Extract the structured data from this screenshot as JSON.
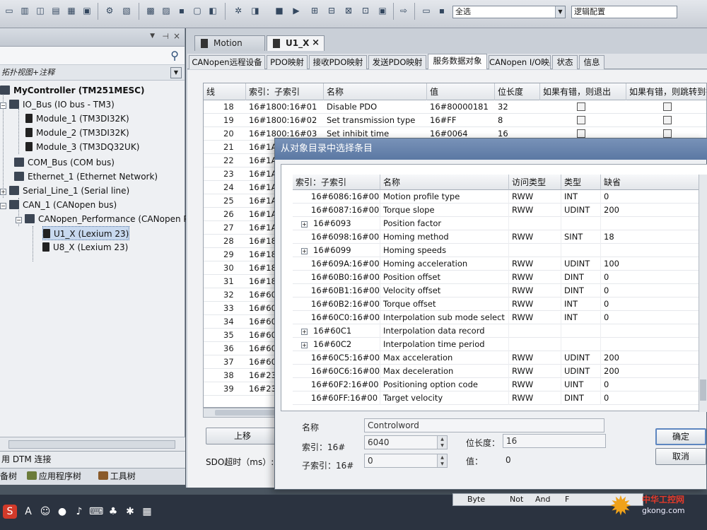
{
  "toolbar": {
    "filter_select": "全选",
    "view_select": "逻辑配置"
  },
  "left_pane": {
    "column_header": "拓扑视图+注释",
    "tree": [
      {
        "label": "MyController (TM251MESC)",
        "bold": true
      },
      {
        "label": "IO_Bus (IO bus - TM3)"
      },
      {
        "label": "Module_1 (TM3DI32K)"
      },
      {
        "label": "Module_2 (TM3DI32K)"
      },
      {
        "label": "Module_3 (TM3DQ32UK)"
      },
      {
        "label": "COM_Bus (COM bus)"
      },
      {
        "label": "Ethernet_1 (Ethernet Network)"
      },
      {
        "label": "Serial_Line_1 (Serial line)"
      },
      {
        "label": "CAN_1 (CANopen bus)"
      },
      {
        "label": "CANopen_Performance (CANopen Per"
      },
      {
        "label": "U1_X (Lexium 23)",
        "selected": true
      },
      {
        "label": "U8_X (Lexium 23)"
      }
    ],
    "status_text": "用 DTM 连接",
    "bottom_tabs": [
      "备树",
      "应用程序树",
      "工具树"
    ]
  },
  "editor": {
    "doc_tabs": [
      "Motion",
      "U1_X"
    ],
    "sub_tabs": [
      "CANopen远程设备",
      "PDO映射",
      "接收PDO映射",
      "发送PDO映射",
      "服务数据对象",
      "CANopen I/O映射",
      "状态",
      "信息"
    ],
    "active_sub_tab": 4,
    "grid": {
      "columns": [
        "线",
        "索引：子索引",
        "名称",
        "值",
        "位长度",
        "如果有错，则退出",
        "如果有错，则跳转到行"
      ],
      "rows": [
        {
          "line": "18",
          "index": "16#1800:16#01",
          "name": "Disable PDO",
          "value": "16#80000181",
          "bits": "32"
        },
        {
          "line": "19",
          "index": "16#1800:16#02",
          "name": "Set transmission type",
          "value": "16#FF",
          "bits": "8"
        },
        {
          "line": "20",
          "index": "16#1800:16#03",
          "name": "Set inhibit time",
          "value": "16#0064",
          "bits": "16"
        },
        {
          "line": "21",
          "index": "16#1A",
          "name": "",
          "value": "",
          "bits": ""
        },
        {
          "line": "22",
          "index": "16#1A",
          "name": "",
          "value": "",
          "bits": ""
        },
        {
          "line": "23",
          "index": "16#1A",
          "name": "",
          "value": "",
          "bits": ""
        },
        {
          "line": "24",
          "index": "16#1A",
          "name": "",
          "value": "",
          "bits": ""
        },
        {
          "line": "25",
          "index": "16#1A",
          "name": "",
          "value": "",
          "bits": ""
        },
        {
          "line": "26",
          "index": "16#1A",
          "name": "",
          "value": "",
          "bits": ""
        },
        {
          "line": "27",
          "index": "16#1A",
          "name": "",
          "value": "",
          "bits": ""
        },
        {
          "line": "28",
          "index": "16#18",
          "name": "",
          "value": "",
          "bits": ""
        },
        {
          "line": "29",
          "index": "16#18",
          "name": "",
          "value": "",
          "bits": ""
        },
        {
          "line": "30",
          "index": "16#18",
          "name": "",
          "value": "",
          "bits": ""
        },
        {
          "line": "31",
          "index": "16#18",
          "name": "",
          "value": "",
          "bits": ""
        },
        {
          "line": "32",
          "index": "16#60",
          "name": "",
          "value": "",
          "bits": ""
        },
        {
          "line": "33",
          "index": "16#60",
          "name": "",
          "value": "",
          "bits": ""
        },
        {
          "line": "34",
          "index": "16#60",
          "name": "",
          "value": "",
          "bits": ""
        },
        {
          "line": "35",
          "index": "16#60",
          "name": "",
          "value": "",
          "bits": ""
        },
        {
          "line": "36",
          "index": "16#60",
          "name": "",
          "value": "",
          "bits": ""
        },
        {
          "line": "37",
          "index": "16#60",
          "name": "",
          "value": "",
          "bits": ""
        },
        {
          "line": "38",
          "index": "16#23",
          "name": "",
          "value": "",
          "bits": ""
        },
        {
          "line": "39",
          "index": "16#23",
          "name": "",
          "value": "",
          "bits": ""
        }
      ]
    },
    "up_button": "上移",
    "sdo_timeout_label": "SDO超时（ms）:"
  },
  "dialog": {
    "title": "从对象目录中选择条目",
    "columns": [
      "索引：子索引",
      "名称",
      "访问类型",
      "类型",
      "缺省"
    ],
    "rows": [
      {
        "expand": false,
        "index": "16#6086:16#00",
        "name": "Motion profile type",
        "access": "RWW",
        "type": "INT",
        "default": "0"
      },
      {
        "expand": false,
        "index": "16#6087:16#00",
        "name": "Torque slope",
        "access": "RWW",
        "type": "UDINT",
        "default": "200"
      },
      {
        "expand": true,
        "index": "16#6093",
        "name": "Position factor",
        "access": "",
        "type": "",
        "default": ""
      },
      {
        "expand": false,
        "index": "16#6098:16#00",
        "name": "Homing method",
        "access": "RWW",
        "type": "SINT",
        "default": "18"
      },
      {
        "expand": true,
        "index": "16#6099",
        "name": "Homing speeds",
        "access": "",
        "type": "",
        "default": ""
      },
      {
        "expand": false,
        "index": "16#609A:16#00",
        "name": "Homing acceleration",
        "access": "RWW",
        "type": "UDINT",
        "default": "100"
      },
      {
        "expand": false,
        "index": "16#60B0:16#00",
        "name": "Position offset",
        "access": "RWW",
        "type": "DINT",
        "default": "0"
      },
      {
        "expand": false,
        "index": "16#60B1:16#00",
        "name": "Velocity offset",
        "access": "RWW",
        "type": "DINT",
        "default": "0"
      },
      {
        "expand": false,
        "index": "16#60B2:16#00",
        "name": "Torque offset",
        "access": "RWW",
        "type": "INT",
        "default": "0"
      },
      {
        "expand": false,
        "index": "16#60C0:16#00",
        "name": "Interpolation sub mode select",
        "access": "RWW",
        "type": "INT",
        "default": "0"
      },
      {
        "expand": true,
        "index": "16#60C1",
        "name": "Interpolation data record",
        "access": "",
        "type": "",
        "default": ""
      },
      {
        "expand": true,
        "index": "16#60C2",
        "name": "Interpolation time period",
        "access": "",
        "type": "",
        "default": ""
      },
      {
        "expand": false,
        "index": "16#60C5:16#00",
        "name": "Max acceleration",
        "access": "RWW",
        "type": "UDINT",
        "default": "200"
      },
      {
        "expand": false,
        "index": "16#60C6:16#00",
        "name": "Max deceleration",
        "access": "RWW",
        "type": "UDINT",
        "default": "200"
      },
      {
        "expand": false,
        "index": "16#60F2:16#00",
        "name": "Positioning option code",
        "access": "RWW",
        "type": "UINT",
        "default": "0"
      },
      {
        "expand": false,
        "index": "16#60FF:16#00",
        "name": "Target velocity",
        "access": "RWW",
        "type": "DINT",
        "default": "0"
      }
    ],
    "name_label": "名称",
    "name_value": "Controlword",
    "index_label": "索引：16#",
    "index_value": "6040",
    "subindex_label": "子索引：16#",
    "subindex_value": "0",
    "bitlen_label": "位长度：",
    "bitlen_value": "16",
    "value_label": "值：",
    "value_value": "0",
    "ok_button": "确定",
    "cancel_button": "取消"
  },
  "bottom_strip": [
    "Byte",
    "Not",
    "And",
    "F"
  ],
  "watermark": {
    "brand": "中华工控网",
    "site": "gkong.com"
  }
}
